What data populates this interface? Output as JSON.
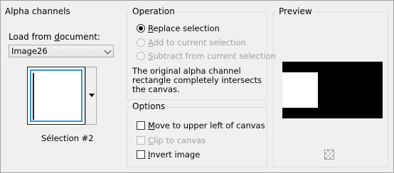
{
  "alpha_channels": {
    "title": "Alpha channels",
    "load_label_pre": "Load from ",
    "load_label_u": "d",
    "load_label_post": "ocument:",
    "document_value": "Image26",
    "selection_name": "Sélection #2"
  },
  "operation": {
    "title": "Operation",
    "options": [
      {
        "u": "R",
        "rest": "eplace selection",
        "checked": true,
        "disabled": false
      },
      {
        "u": "A",
        "rest": "dd to current selection",
        "checked": false,
        "disabled": true
      },
      {
        "u": "S",
        "rest": "ubtract from current selection",
        "checked": false,
        "disabled": true
      }
    ],
    "description": "The original alpha channel rectangle completely intersects the canvas."
  },
  "options": {
    "title": "Options",
    "items": [
      {
        "u": "M",
        "rest": "ove to upper left of canvas",
        "checked": false,
        "disabled": false
      },
      {
        "u": "C",
        "rest": "lip to canvas",
        "checked": false,
        "disabled": true
      },
      {
        "u": "I",
        "rest": "nvert image",
        "checked": false,
        "disabled": false
      }
    ]
  },
  "preview": {
    "title": "Preview"
  },
  "colors": {
    "focus_border": "#3a8fd8",
    "disabled_text": "#a0a0a0"
  }
}
